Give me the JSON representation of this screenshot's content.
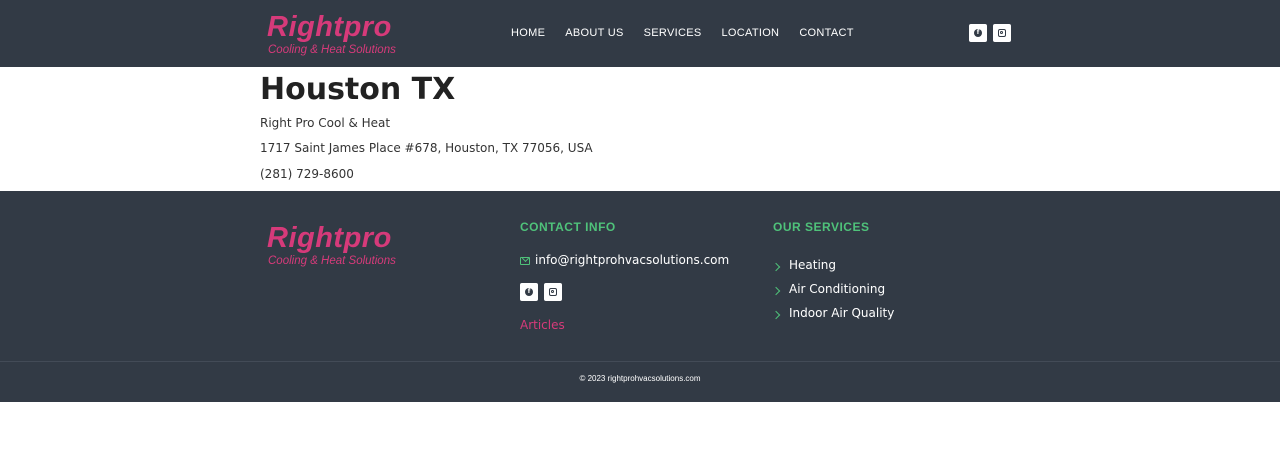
{
  "brand": {
    "name": "Rightpro",
    "tagline": "Cooling & Heat Solutions"
  },
  "nav": {
    "items": [
      "HOME",
      "ABOUT US",
      "SERVICES",
      "LOCATION",
      "CONTACT"
    ]
  },
  "social": {
    "icons": [
      "facebook-icon",
      "instagram-icon"
    ]
  },
  "main": {
    "title": "Houston TX",
    "business_name": "Right Pro Cool & Heat",
    "address": "1717 Saint James Place #678, Houston, TX 77056, USA",
    "phone": "(281) 729-8600"
  },
  "footer": {
    "contact_heading": "CONTACT INFO",
    "email": "info@rightprohvacsolutions.com",
    "articles_label": "Articles",
    "services_heading": "OUR SERVICES",
    "services": [
      "Heating",
      "Air Conditioning",
      "Indoor Air Quality"
    ],
    "copyright": "© 2023 rightprohvacsolutions.com"
  },
  "colors": {
    "header_bg": "#323a45",
    "brand_pink": "#d63a7a",
    "accent_green": "#4fc27a"
  }
}
